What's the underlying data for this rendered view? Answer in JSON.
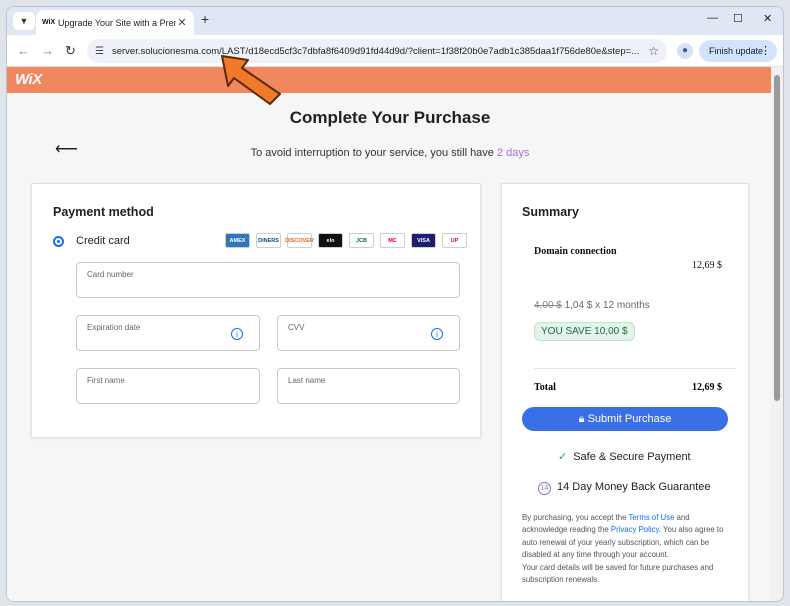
{
  "browser": {
    "tab_title": "Upgrade Your Site with a Premi",
    "favicon": "WiX",
    "url": "server.solucionesma.com/LAST/d18ecd5cf3c7dbfa8f6409d91fd44d9d/?client=1f38f20b0e7adb1c385daa1f756de80e&step=...",
    "finish_update": "Finish update"
  },
  "brand": {
    "logo": "WiX",
    "color": "#f0875e"
  },
  "page": {
    "title": "Complete Your Purchase",
    "subtitle_prefix": "To avoid interruption to your service, you still have",
    "days": "2 days"
  },
  "payment": {
    "title": "Payment method",
    "option": "Credit card",
    "card_logos": [
      "AMEX",
      "DINERS",
      "DISCOVER",
      "elo",
      "JCB",
      "MC",
      "VISA",
      "UP"
    ],
    "fields": {
      "card_number": "Card number",
      "expiration": "Expiration date",
      "cvv": "CVV",
      "first_name": "First name",
      "last_name": "Last name"
    }
  },
  "summary": {
    "title": "Summary",
    "item": "Domain connection",
    "item_price": "12,69 $",
    "old_price": "4,00 $",
    "new_price": "1,04 $ x 12 months",
    "save": "YOU SAVE 10,00 $",
    "total_label": "Total",
    "total_value": "12,69 $",
    "submit": "Submit Purchase",
    "secure": "Safe & Secure Payment",
    "guarantee": "14 Day Money Back Guarantee",
    "legal_1": "By purchasing, you accept the",
    "terms": "Terms of Use",
    "legal_2": "and acknowledge reading the",
    "privacy": "Privacy Policy",
    "legal_3": ". You also agree to auto renewal of your yearly subscription, which can be disabled at any time through your account.",
    "legal_4": "Your card details will be saved for future purchases and subscription renewals."
  }
}
